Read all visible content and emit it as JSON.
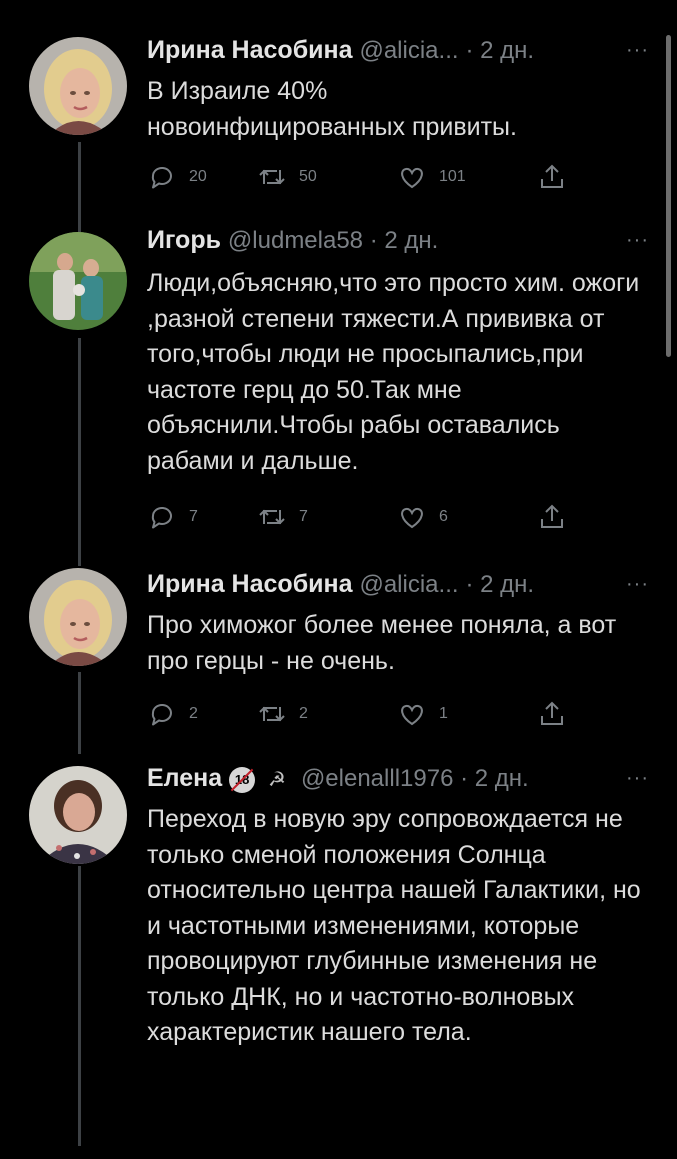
{
  "tweets": [
    {
      "name": "Ирина Насобина",
      "handle": "@alicia...",
      "time": "· 2 дн.",
      "more": "···",
      "text": "В Израиле 40% новоинфицированных привиты.",
      "replies": "20",
      "retweets": "50",
      "likes": "101"
    },
    {
      "name": "Игорь",
      "handle": "@ludmela58 · 2 дн.",
      "time": "",
      "more": "···",
      "text": "Люди,объясняю,что это просто хим. ожоги ,разной степени тяжести.А прививка от того,чтобы люди не просыпались,при частоте герц до 50.Так мне объяснили.Чтобы рабы оставались рабами и дальше.",
      "replies": "7",
      "retweets": "7",
      "likes": "6"
    },
    {
      "name": "Ирина Насобина",
      "handle": "@alicia...",
      "time": "· 2 дн.",
      "more": "···",
      "text": "Про химожог более менее поняла, а вот про герцы - не очень.",
      "replies": "2",
      "retweets": "2",
      "likes": "1"
    },
    {
      "name": "Елена",
      "handle": "@elenalll1976 · 2 дн.",
      "time": "",
      "more": "···",
      "text": "Переход в новую эру сопровождается не только сменой положения Солнца относительно центра нашей Галактики, но и частотными изменениями, которые провоцируют глубинные изменения не только ДНК, но и частотно-волновых характеристик нашего тела.",
      "emoji_badge": "18",
      "emoji_symbol": "☭"
    }
  ]
}
